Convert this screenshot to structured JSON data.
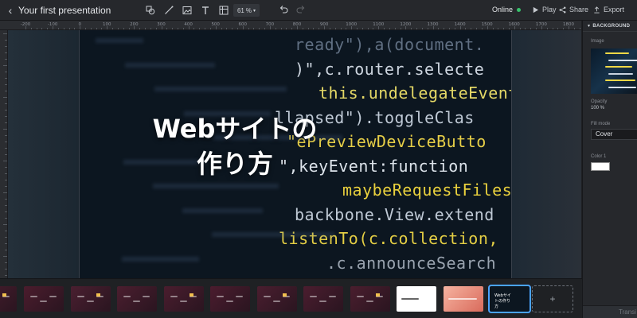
{
  "header": {
    "back_label": "‹",
    "title": "Your first presentation",
    "zoom_value": "61",
    "zoom_unit": "%",
    "status": "Online",
    "play_label": "Play",
    "share_label": "Share",
    "export_label": "Export",
    "icons": [
      "shape-icon",
      "line-icon",
      "image-icon",
      "text-icon",
      "table-icon",
      "undo-icon",
      "redo-icon",
      "play-icon",
      "share-icon",
      "export-icon"
    ]
  },
  "ruler": {
    "labels": [
      "-200",
      "-100",
      "0",
      "100",
      "200",
      "300",
      "400",
      "500",
      "600",
      "700",
      "800",
      "900",
      "1000",
      "1100",
      "1200",
      "1300",
      "1400",
      "1500",
      "1600",
      "1700",
      "1800"
    ]
  },
  "slide": {
    "title_line1": "Webサイトの",
    "title_line2": "作り方",
    "code_lines": [
      "ready\"),a(document.",
      ")\",c.router.selecte",
      "this.undelegateEvents",
      "llapsed\").toggleClas",
      "\"ePreviewDeviceButto",
      "\",keyEvent:function",
      "maybeRequestFilesyst",
      "backbone.View.extend",
      "listenTo(c.collection,",
      ".c.announceSearch"
    ]
  },
  "panel": {
    "section_title": "BACKGROUND",
    "image_label": "Image",
    "opacity_label": "Opacity",
    "opacity_value": "100 %",
    "fill_mode_label": "Fill mode",
    "fill_mode_value": "Cover",
    "color_label": "Color 1",
    "color_value": "#ffffff",
    "footer_label": "Transi"
  },
  "filmstrip": {
    "add_label": "+",
    "selected_index": 11,
    "thumbs": [
      {
        "title": "",
        "bg": "#4a1e2e"
      },
      {
        "title": "",
        "bg": "#4b1c2d"
      },
      {
        "title": "",
        "bg": "#4a1f30"
      },
      {
        "title": "",
        "bg": "#4b1e2f"
      },
      {
        "title": "",
        "bg": "#4a1d2e"
      },
      {
        "title": "",
        "bg": "#4b1c2e"
      },
      {
        "title": "",
        "bg": "#4a1e2f"
      },
      {
        "title": "",
        "bg": "#4b1d2f"
      },
      {
        "title": "",
        "bg": "#4a1e2e"
      },
      {
        "title": "",
        "bg": "#ffffff"
      },
      {
        "title": "",
        "bg": "#e88b7a"
      },
      {
        "title": "Webサイトの作り方",
        "bg": "#0c1620"
      }
    ]
  }
}
